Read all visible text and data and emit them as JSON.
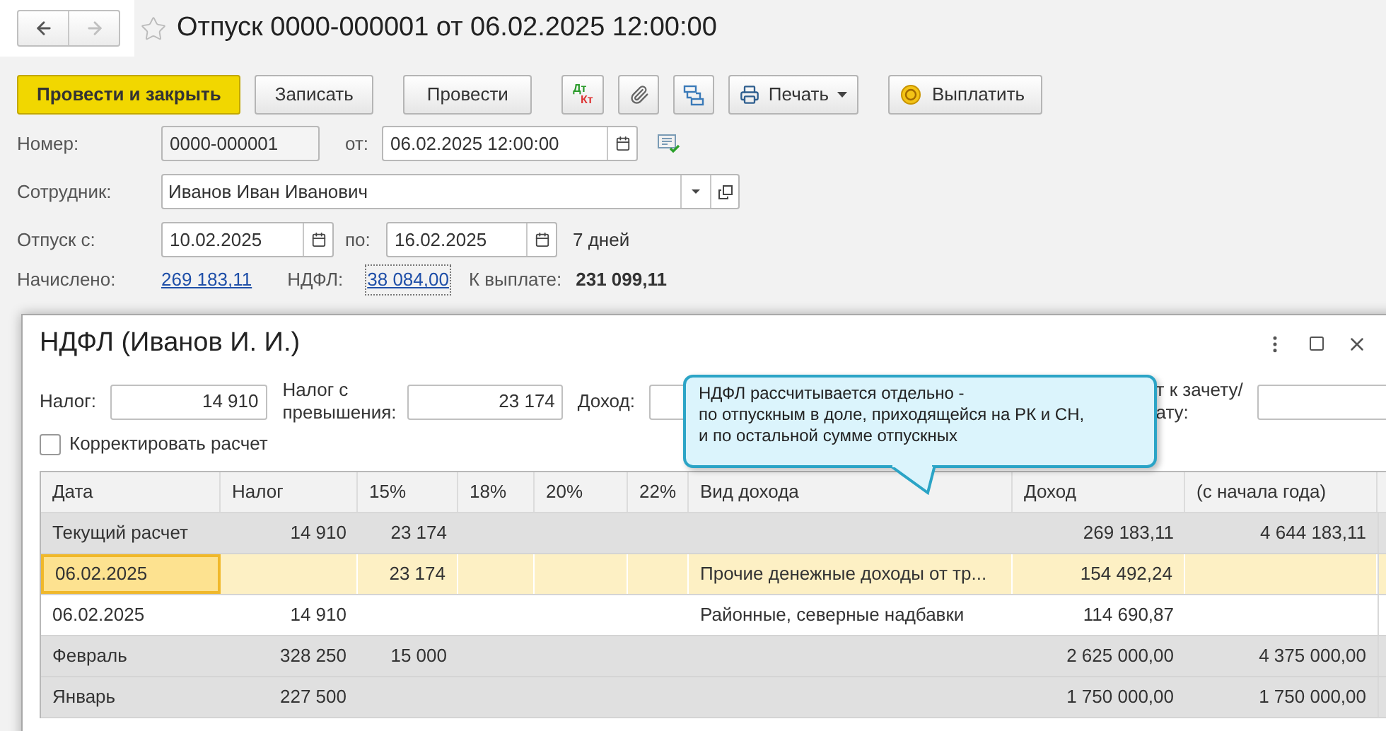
{
  "nav": {
    "back": {
      "disabled": false
    },
    "forward": {
      "disabled": true
    }
  },
  "favorite": false,
  "title": "Отпуск 0000-000001 от 06.02.2025 12:00:00",
  "toolbar": {
    "primary_button": "Провести и закрыть",
    "buttons": [
      "Записать",
      "Провести"
    ],
    "accounting_button": {
      "debit": "Дт",
      "credit": "Кт"
    },
    "print_button": "Печать",
    "pay_button": "Выплатить"
  },
  "form": {
    "number_label": "Номер:",
    "number": "0000-000001",
    "date_label": "от:",
    "date": "06.02.2025 12:00:00",
    "employee_label": "Сотрудник:",
    "employee": "Иванов Иван Иванович",
    "vacation_from_label": "Отпуск с:",
    "vacation_from": "10.02.2025",
    "to_label": "по:",
    "vacation_to": "16.02.2025",
    "days": "7 дней",
    "accrued_label": "Начислено:",
    "accrued": "269 183,11",
    "ndfl_label": "НДФЛ:",
    "ndfl": "38 084,00",
    "payout_label": "К выплате:",
    "payout": "231 099,11"
  },
  "dialog": {
    "title": "НДФЛ (Иванов И. И.)",
    "tax_label": "Налог:",
    "tax": "14 910",
    "excess_label": "Налог с превышения:",
    "excess": "23 174",
    "income_label": "Доход:",
    "offset_label_lines": [
      "т к зачету/",
      "ату:"
    ],
    "correct": {
      "label": "Корректировать расчет",
      "checked": false
    },
    "table": {
      "columns": [
        "Дата",
        "Налог",
        "15%",
        "18%",
        "20%",
        "22%",
        "Вид дохода",
        "Доход",
        "(с начала года)"
      ],
      "rows": [
        {
          "kind": "total",
          "selected": false,
          "date": "Текущий расчет",
          "tax": "14 910",
          "p15": "23 174",
          "income": "269 183,11",
          "ytd": "4 644 183,11"
        },
        {
          "kind": "detail",
          "selected": true,
          "date": "06.02.2025",
          "p15": "23 174",
          "income_type": "Прочие денежные доходы от тр...",
          "income": "154 492,24"
        },
        {
          "kind": "detail",
          "selected": false,
          "date": "06.02.2025",
          "tax": "14 910",
          "income_type": "Районные, северные надбавки",
          "income": "114 690,87"
        },
        {
          "kind": "total",
          "selected": false,
          "date": "Февраль",
          "tax": "328 250",
          "p15": "15 000",
          "income": "2 625 000,00",
          "ytd": "4 375 000,00"
        },
        {
          "kind": "total",
          "selected": false,
          "date": "Январь",
          "tax": "227 500",
          "income": "1 750 000,00",
          "ytd": "1 750 000,00"
        }
      ]
    }
  },
  "tooltip": {
    "text": "НДФЛ рассчитывается отдельно -\nпо отпускным в доле, приходящейся на РК и СН,\nи по остальной сумме отпускных"
  }
}
